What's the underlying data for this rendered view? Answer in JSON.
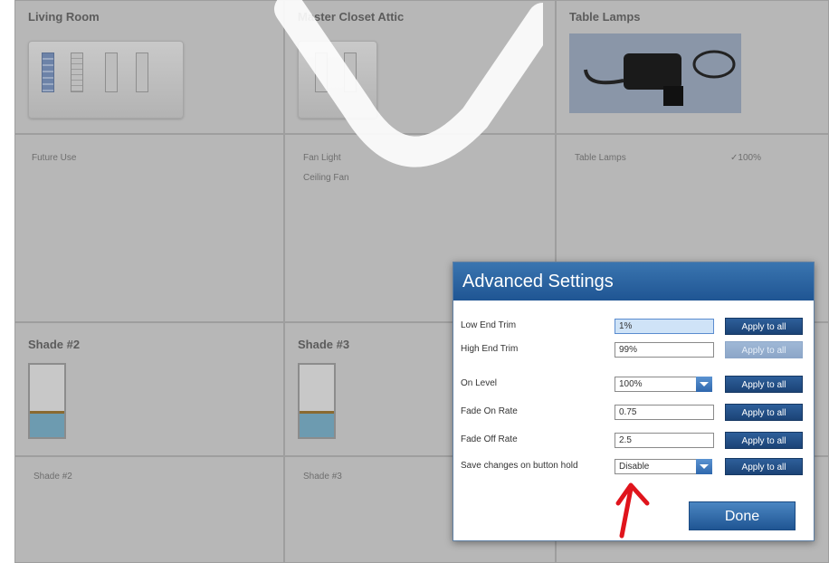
{
  "rooms": [
    {
      "title": "Living Room",
      "items": [
        "Future Use"
      ]
    },
    {
      "title": "Master Closet Attic",
      "items": [
        "Fan Light",
        "Ceiling Fan"
      ]
    },
    {
      "title": "Table Lamps",
      "items": [
        "Table Lamps"
      ],
      "level": "100%"
    }
  ],
  "shades": [
    {
      "title": "Shade #2",
      "item": "Shade #2"
    },
    {
      "title": "Shade #3",
      "item": "Shade #3"
    }
  ],
  "dialog": {
    "title": "Advanced Settings",
    "apply_label": "Apply to all",
    "done_label": "Done",
    "rows": [
      {
        "label": "Low End Trim",
        "value": "1%",
        "type": "text",
        "selected": true,
        "apply_enabled": true
      },
      {
        "label": "High End Trim",
        "value": "99%",
        "type": "text",
        "apply_enabled": false
      },
      {
        "label": "On Level",
        "value": "100%",
        "type": "dropdown",
        "apply_enabled": true
      },
      {
        "label": "Fade On Rate",
        "value": "0.75",
        "type": "text",
        "apply_enabled": true
      },
      {
        "label": "Fade Off Rate",
        "value": "2.5",
        "type": "text",
        "apply_enabled": true
      },
      {
        "label": "Save changes on button hold",
        "value": "Disable",
        "type": "dropdown",
        "apply_enabled": true
      }
    ]
  },
  "colors": {
    "dialog_header": "#1f5593",
    "apply_button": "#1b4376",
    "arrow": "#e0141c"
  }
}
